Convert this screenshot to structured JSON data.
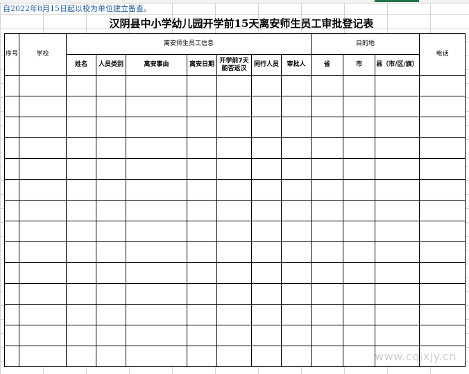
{
  "notice": "自2022年8月15日起以校为单位建立备查。",
  "title": "汉阴县中小学幼儿园开学前15天离安师生员工审批登记表",
  "headers": {
    "seq": "序号",
    "school": "学校",
    "info_group": "离安师生员工信息",
    "destination_group": "目的地",
    "phone": "电话",
    "name": "姓名",
    "person_type": "人员类别",
    "reason": "离安事由",
    "leave_date": "离安日期",
    "returned": "开学前7天能否返汉",
    "companions": "同行人员",
    "approver": "审批人",
    "province": "省",
    "city": "市",
    "county": "县（市/区/旗）"
  },
  "watermark": "www.cqjxjy.cn",
  "empty_rows": 14
}
